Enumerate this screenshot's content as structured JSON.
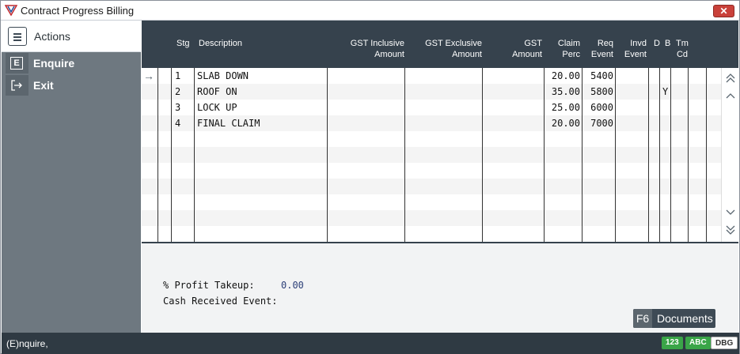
{
  "window": {
    "title": "Contract Progress Billing",
    "close_glyph": "✕"
  },
  "sidebar": {
    "header_label": "Actions",
    "items": [
      {
        "key": "E",
        "label": "Enquire",
        "icon": "enquire-key-icon"
      },
      {
        "key": "→",
        "label": "Exit",
        "icon": "exit-icon"
      }
    ]
  },
  "grid": {
    "columns": [
      {
        "label": "Stg"
      },
      {
        "label": "Description"
      },
      {
        "label_line1": "GST Inclusive",
        "label_line2": "Amount"
      },
      {
        "label_line1": "GST Exclusive",
        "label_line2": "Amount"
      },
      {
        "label_line1": "GST",
        "label_line2": "Amount"
      },
      {
        "label_line1": "Claim",
        "label_line2": "Perc"
      },
      {
        "label_line1": "Req",
        "label_line2": "Event"
      },
      {
        "label_line1": "Invd",
        "label_line2": "Event"
      },
      {
        "label": "D"
      },
      {
        "label": "B"
      },
      {
        "label_line1": "Tm",
        "label_line2": "Cd"
      }
    ],
    "rows": [
      {
        "stg": "1",
        "description": "SLAB DOWN",
        "claim_perc": "20.00",
        "req_event": "5400",
        "b": ""
      },
      {
        "stg": "2",
        "description": "ROOF ON",
        "claim_perc": "35.00",
        "req_event": "5800",
        "b": "Y"
      },
      {
        "stg": "3",
        "description": "LOCK UP",
        "claim_perc": "25.00",
        "req_event": "6000",
        "b": ""
      },
      {
        "stg": "4",
        "description": "FINAL CLAIM",
        "claim_perc": "20.00",
        "req_event": "7000",
        "b": ""
      }
    ]
  },
  "footer": {
    "profit_takeup_label": "% Profit Takeup:",
    "profit_takeup_value": "0.00",
    "cash_received_label": "Cash Received Event:",
    "cash_received_value": "",
    "f6_key": "F6",
    "f6_label": "Documents"
  },
  "statusbar": {
    "text": "(E)nquire,",
    "badges": [
      "123",
      "ABC",
      "DBG"
    ]
  }
}
